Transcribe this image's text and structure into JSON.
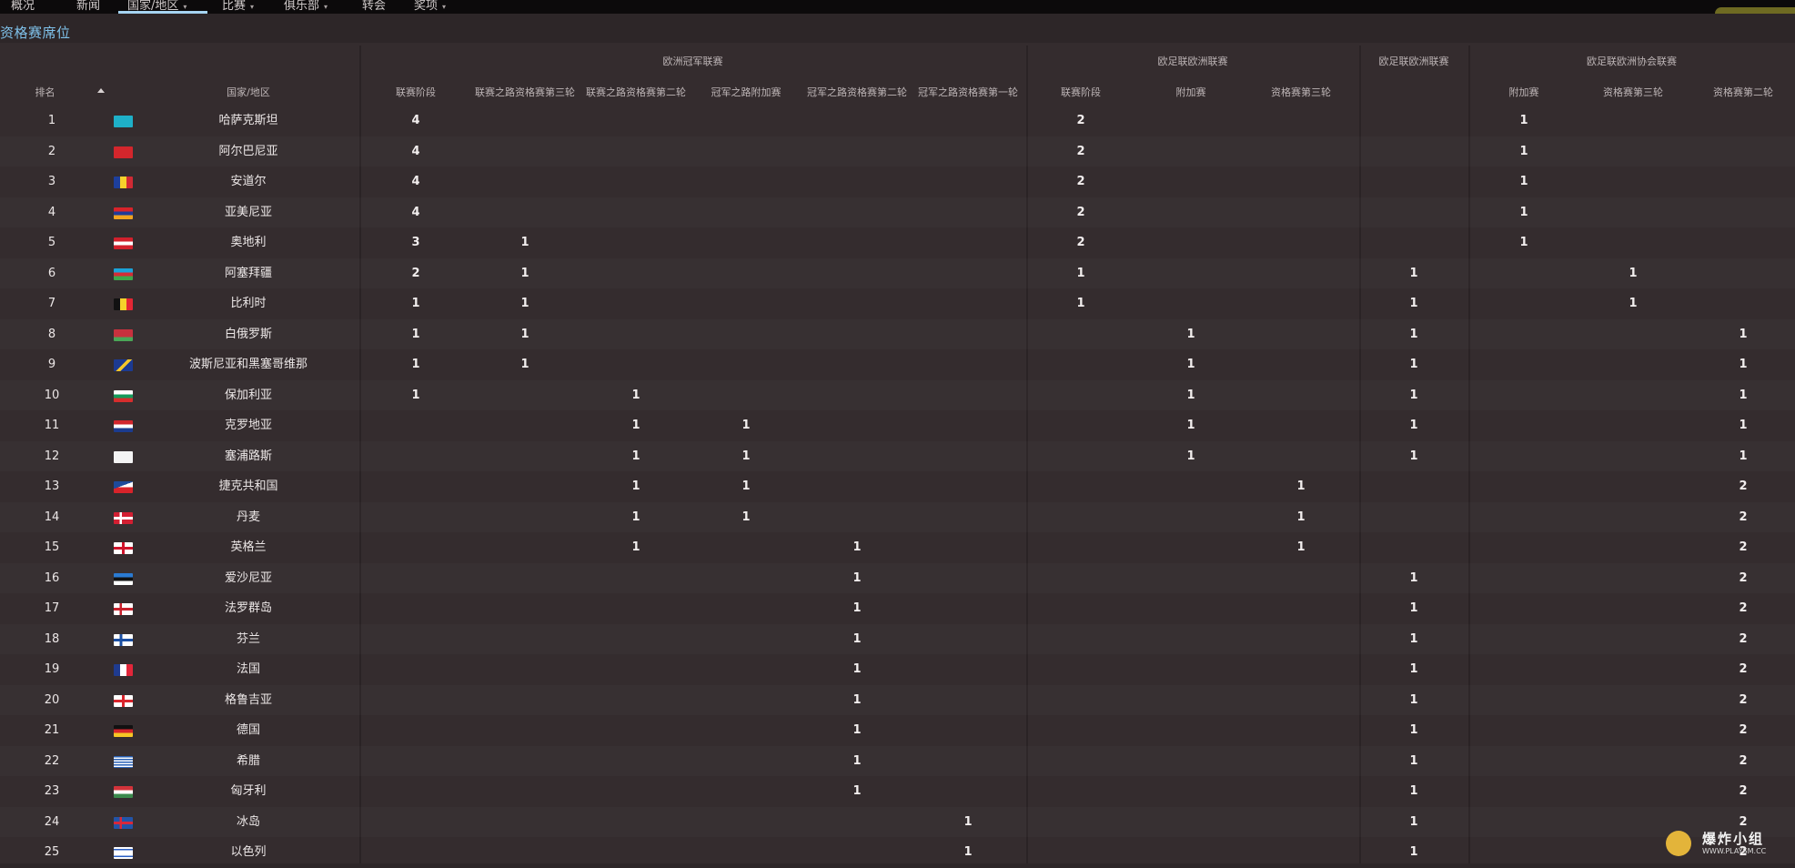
{
  "nav": {
    "items": [
      {
        "label": "概况",
        "dropdown": false
      },
      {
        "label": "新闻",
        "dropdown": false
      },
      {
        "label": "国家/地区",
        "dropdown": true,
        "active": true
      },
      {
        "label": "比赛",
        "dropdown": true
      },
      {
        "label": "俱乐部",
        "dropdown": true
      },
      {
        "label": "转会",
        "dropdown": false
      },
      {
        "label": "奖项",
        "dropdown": true
      }
    ]
  },
  "page_title": "资格赛席位",
  "table": {
    "groups": [
      "欧洲冠军联赛",
      "欧足联欧洲联赛",
      "欧足联欧洲联赛",
      "欧足联欧洲协会联赛"
    ],
    "fixed_headers": {
      "rank": "排名",
      "country": "国家/地区"
    },
    "columns": [
      "联赛阶段",
      "联赛之路资格赛第三轮",
      "联赛之路资格赛第二轮",
      "冠军之路附加赛",
      "冠军之路资格赛第二轮",
      "冠军之路资格赛第一轮",
      "联赛阶段",
      "附加赛",
      "资格赛第三轮",
      "",
      "附加赛",
      "资格赛第三轮",
      "资格赛第二轮"
    ],
    "rows": [
      {
        "rank": "1",
        "country": "哈萨克斯坦",
        "flag": "kz",
        "values": [
          "4",
          "",
          "",
          "",
          "",
          "",
          "2",
          "",
          "",
          "",
          "1",
          "",
          ""
        ]
      },
      {
        "rank": "2",
        "country": "阿尔巴尼亚",
        "flag": "al",
        "values": [
          "4",
          "",
          "",
          "",
          "",
          "",
          "2",
          "",
          "",
          "",
          "1",
          "",
          ""
        ]
      },
      {
        "rank": "3",
        "country": "安道尔",
        "flag": "ad",
        "values": [
          "4",
          "",
          "",
          "",
          "",
          "",
          "2",
          "",
          "",
          "",
          "1",
          "",
          ""
        ]
      },
      {
        "rank": "4",
        "country": "亚美尼亚",
        "flag": "am",
        "values": [
          "4",
          "",
          "",
          "",
          "",
          "",
          "2",
          "",
          "",
          "",
          "1",
          "",
          ""
        ]
      },
      {
        "rank": "5",
        "country": "奥地利",
        "flag": "at",
        "values": [
          "3",
          "1",
          "",
          "",
          "",
          "",
          "2",
          "",
          "",
          "",
          "1",
          "",
          ""
        ]
      },
      {
        "rank": "6",
        "country": "阿塞拜疆",
        "flag": "az",
        "values": [
          "2",
          "1",
          "",
          "",
          "",
          "",
          "1",
          "",
          "",
          "1",
          "",
          "1",
          ""
        ]
      },
      {
        "rank": "7",
        "country": "比利时",
        "flag": "be",
        "values": [
          "1",
          "1",
          "",
          "",
          "",
          "",
          "1",
          "",
          "",
          "1",
          "",
          "1",
          ""
        ]
      },
      {
        "rank": "8",
        "country": "白俄罗斯",
        "flag": "by",
        "values": [
          "1",
          "1",
          "",
          "",
          "",
          "",
          "",
          "1",
          "",
          "1",
          "",
          "",
          "1"
        ]
      },
      {
        "rank": "9",
        "country": "波斯尼亚和黑塞哥维那",
        "flag": "ba",
        "values": [
          "1",
          "1",
          "",
          "",
          "",
          "",
          "",
          "1",
          "",
          "1",
          "",
          "",
          "1"
        ]
      },
      {
        "rank": "10",
        "country": "保加利亚",
        "flag": "bg",
        "values": [
          "1",
          "",
          "1",
          "",
          "",
          "",
          "",
          "1",
          "",
          "1",
          "",
          "",
          "1"
        ]
      },
      {
        "rank": "11",
        "country": "克罗地亚",
        "flag": "hr",
        "values": [
          "",
          "",
          "1",
          "1",
          "",
          "",
          "",
          "1",
          "",
          "1",
          "",
          "",
          "1"
        ]
      },
      {
        "rank": "12",
        "country": "塞浦路斯",
        "flag": "cy",
        "values": [
          "",
          "",
          "1",
          "1",
          "",
          "",
          "",
          "1",
          "",
          "1",
          "",
          "",
          "1"
        ]
      },
      {
        "rank": "13",
        "country": "捷克共和国",
        "flag": "cz",
        "values": [
          "",
          "",
          "1",
          "1",
          "",
          "",
          "",
          "",
          "1",
          "",
          "",
          "",
          "2"
        ]
      },
      {
        "rank": "14",
        "country": "丹麦",
        "flag": "dk",
        "values": [
          "",
          "",
          "1",
          "1",
          "",
          "",
          "",
          "",
          "1",
          "",
          "",
          "",
          "2"
        ]
      },
      {
        "rank": "15",
        "country": "英格兰",
        "flag": "en",
        "values": [
          "",
          "",
          "1",
          "",
          "1",
          "",
          "",
          "",
          "1",
          "",
          "",
          "",
          "2"
        ]
      },
      {
        "rank": "16",
        "country": "爱沙尼亚",
        "flag": "ee",
        "values": [
          "",
          "",
          "",
          "",
          "1",
          "",
          "",
          "",
          "",
          "1",
          "",
          "",
          "2"
        ]
      },
      {
        "rank": "17",
        "country": "法罗群岛",
        "flag": "fo",
        "values": [
          "",
          "",
          "",
          "",
          "1",
          "",
          "",
          "",
          "",
          "1",
          "",
          "",
          "2"
        ]
      },
      {
        "rank": "18",
        "country": "芬兰",
        "flag": "fi",
        "values": [
          "",
          "",
          "",
          "",
          "1",
          "",
          "",
          "",
          "",
          "1",
          "",
          "",
          "2"
        ]
      },
      {
        "rank": "19",
        "country": "法国",
        "flag": "fr",
        "values": [
          "",
          "",
          "",
          "",
          "1",
          "",
          "",
          "",
          "",
          "1",
          "",
          "",
          "2"
        ]
      },
      {
        "rank": "20",
        "country": "格鲁吉亚",
        "flag": "ge",
        "values": [
          "",
          "",
          "",
          "",
          "1",
          "",
          "",
          "",
          "",
          "1",
          "",
          "",
          "2"
        ]
      },
      {
        "rank": "21",
        "country": "德国",
        "flag": "de",
        "values": [
          "",
          "",
          "",
          "",
          "1",
          "",
          "",
          "",
          "",
          "1",
          "",
          "",
          "2"
        ]
      },
      {
        "rank": "22",
        "country": "希腊",
        "flag": "gr",
        "values": [
          "",
          "",
          "",
          "",
          "1",
          "",
          "",
          "",
          "",
          "1",
          "",
          "",
          "2"
        ]
      },
      {
        "rank": "23",
        "country": "匈牙利",
        "flag": "hu",
        "values": [
          "",
          "",
          "",
          "",
          "1",
          "",
          "",
          "",
          "",
          "1",
          "",
          "",
          "2"
        ]
      },
      {
        "rank": "24",
        "country": "冰岛",
        "flag": "is",
        "values": [
          "",
          "",
          "",
          "",
          "",
          "1",
          "",
          "",
          "",
          "1",
          "",
          "",
          "2"
        ]
      },
      {
        "rank": "25",
        "country": "以色列",
        "flag": "il",
        "values": [
          "",
          "",
          "",
          "",
          "",
          "1",
          "",
          "",
          "",
          "1",
          "",
          "",
          "2"
        ]
      }
    ]
  },
  "watermark": {
    "text": "爆炸小组",
    "url": "WWW.PLAYSM.CC"
  },
  "colors": {
    "background": "#2d2628",
    "accent": "#7fc1ea",
    "topbar": "#0c0a0b"
  }
}
